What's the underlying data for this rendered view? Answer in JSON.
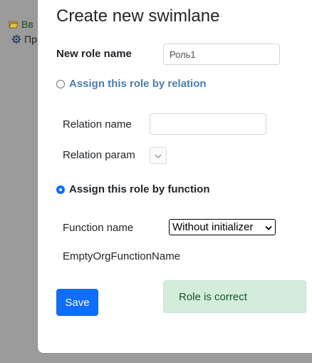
{
  "background": {
    "tree_items": [
      {
        "label": "Вв",
        "icon": "folder-open-icon"
      },
      {
        "label": "Пр",
        "icon": "gear-icon"
      }
    ]
  },
  "modal": {
    "title": "Create new swimlane",
    "role_name_label": "New role name",
    "role_name_value": "Роль1",
    "assign_relation_label": "Assign this role by relation",
    "assign_relation_checked": false,
    "relation_name_label": "Relation name",
    "relation_name_value": "",
    "relation_param_label": "Relation param",
    "assign_function_label": "Assign this role by function",
    "assign_function_checked": true,
    "function_name_label": "Function name",
    "function_name_selected": "Without initializer",
    "function_hint": "EmptyOrgFunctionName",
    "save_label": "Save",
    "status_message": "Role is correct"
  },
  "colors": {
    "primary": "#0d6efd",
    "success_bg": "#d4ecdc",
    "success_text": "#155724",
    "relation_link": "#4a7fae",
    "backdrop": "#9b9b9b"
  }
}
